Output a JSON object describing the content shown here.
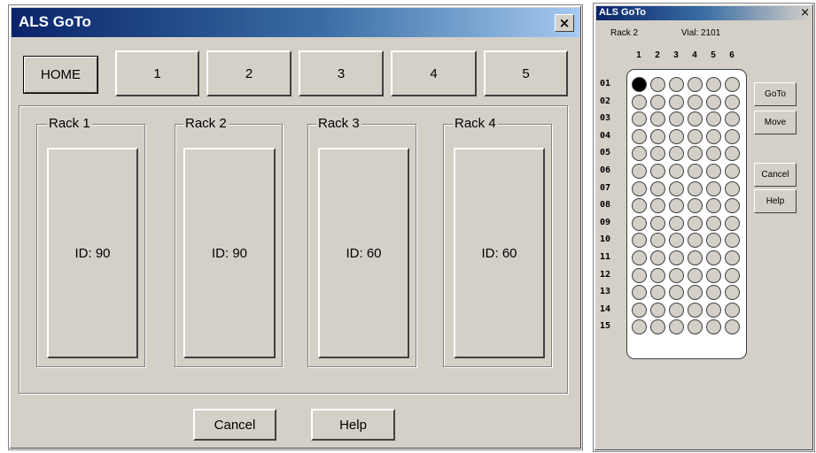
{
  "main_dialog": {
    "title": "ALS GoTo",
    "close_glyph": "×",
    "nav_buttons": [
      "HOME",
      "1",
      "2",
      "3",
      "4",
      "5"
    ],
    "racks": [
      {
        "label": "Rack 1",
        "id_text": "ID: 90"
      },
      {
        "label": "Rack 2",
        "id_text": "ID: 90"
      },
      {
        "label": "Rack 3",
        "id_text": "ID: 60"
      },
      {
        "label": "Rack 4",
        "id_text": "ID: 60"
      }
    ],
    "cancel_label": "Cancel",
    "help_label": "Help"
  },
  "vial_dialog": {
    "title": "ALS GoTo",
    "close_glyph": "×",
    "rack_text": "Rack 2",
    "vial_text": "Vial: 2101",
    "columns": [
      "1",
      "2",
      "3",
      "4",
      "5",
      "6"
    ],
    "rows": [
      "01",
      "02",
      "03",
      "04",
      "05",
      "06",
      "07",
      "08",
      "09",
      "10",
      "11",
      "12",
      "13",
      "14",
      "15"
    ],
    "selected_vial": {
      "row": "01",
      "column": "1"
    },
    "goto_label": "GoTo",
    "move_label": "Move",
    "cancel_label": "Cancel",
    "help_label": "Help"
  },
  "colors": {
    "dialog_bg": "#d4d0c8",
    "title_start": "#0a246a",
    "title_end": "#a6caf0",
    "selected_vial": "#000000"
  }
}
